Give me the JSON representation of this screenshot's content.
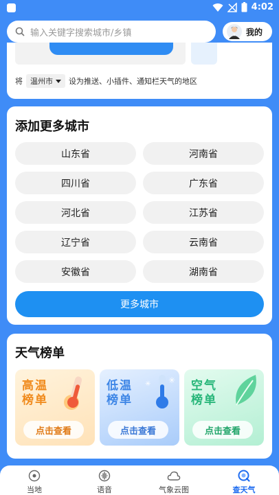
{
  "status": {
    "time": "4:02"
  },
  "search": {
    "placeholder": "输入关键字搜索城市/乡镇"
  },
  "mine": {
    "label": "我的"
  },
  "setting": {
    "prefix": "将",
    "city": "温州市",
    "suffix": "设为推送、小插件、通知栏天气的地区"
  },
  "add_city": {
    "title": "添加更多城市",
    "provinces": [
      "山东省",
      "河南省",
      "四川省",
      "广东省",
      "河北省",
      "江苏省",
      "辽宁省",
      "云南省",
      "安徽省",
      "湖南省"
    ],
    "more_button": "更多城市"
  },
  "ranking": {
    "title": "天气榜单",
    "cards": [
      {
        "line1": "高温",
        "line2": "榜单",
        "button": "点击查看"
      },
      {
        "line1": "低温",
        "line2": "榜单",
        "button": "点击查看"
      },
      {
        "line1": "空气",
        "line2": "榜单",
        "button": "点击查看"
      }
    ]
  },
  "tabs": [
    {
      "label": "当地",
      "icon": "location-icon"
    },
    {
      "label": "语音",
      "icon": "voice-icon"
    },
    {
      "label": "气象云图",
      "icon": "cloud-icon"
    },
    {
      "label": "查天气",
      "icon": "search-weather-icon",
      "active": true
    }
  ],
  "colors": {
    "background": "#3f8cf7",
    "accent": "#1e90f2",
    "active_tab": "#1e6cf0"
  }
}
